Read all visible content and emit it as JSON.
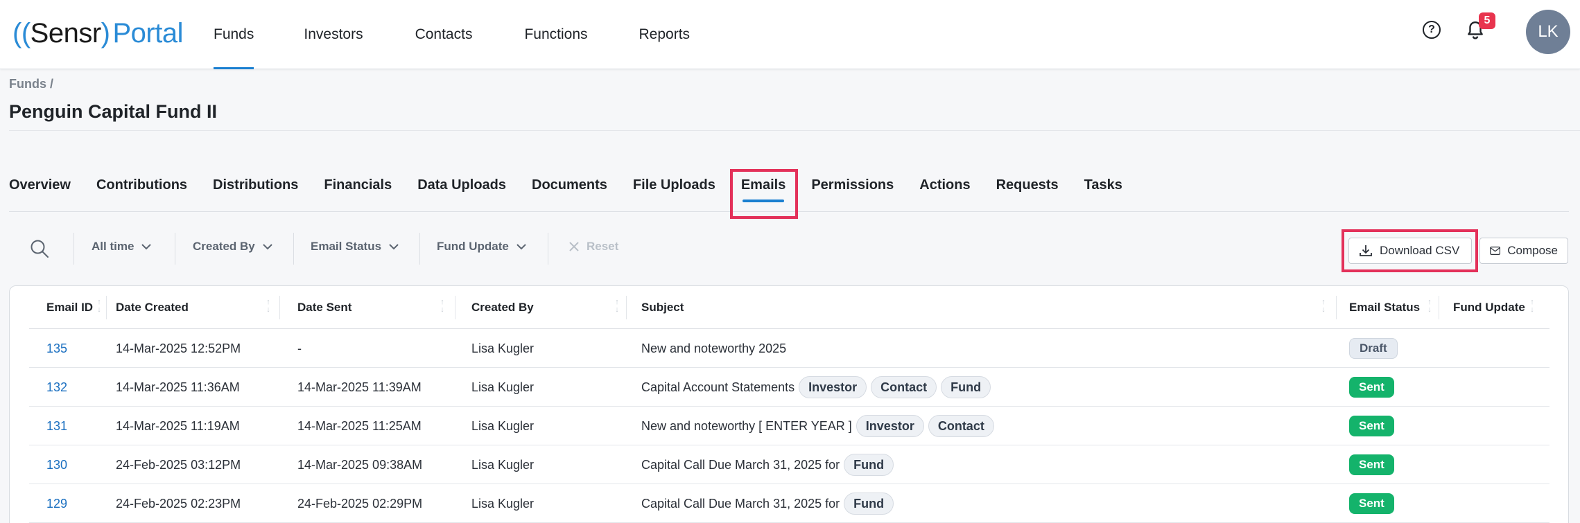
{
  "app": {
    "logo_open": "((",
    "logo_brand": "Sensr",
    "logo_close": ")",
    "logo_product": "Portal",
    "notifications_count": "5",
    "user_initials": "LK"
  },
  "nav": {
    "items": [
      {
        "label": "Funds",
        "active": true
      },
      {
        "label": "Investors",
        "active": false
      },
      {
        "label": "Contacts",
        "active": false
      },
      {
        "label": "Functions",
        "active": false
      },
      {
        "label": "Reports",
        "active": false
      }
    ]
  },
  "header": {
    "breadcrumb": "Funds /",
    "title": "Penguin Capital Fund II"
  },
  "tabs": [
    {
      "label": "Overview"
    },
    {
      "label": "Contributions"
    },
    {
      "label": "Distributions"
    },
    {
      "label": "Financials"
    },
    {
      "label": "Data Uploads"
    },
    {
      "label": "Documents"
    },
    {
      "label": "File Uploads"
    },
    {
      "label": "Emails",
      "active": true
    },
    {
      "label": "Permissions"
    },
    {
      "label": "Actions"
    },
    {
      "label": "Requests"
    },
    {
      "label": "Tasks"
    }
  ],
  "filters": {
    "time": "All time",
    "created_by": "Created By",
    "email_status": "Email Status",
    "fund_update": "Fund Update",
    "reset": "Reset"
  },
  "actions": {
    "download_csv": "Download CSV",
    "compose": "Compose"
  },
  "table": {
    "columns": [
      "Email ID",
      "Date Created",
      "Date Sent",
      "Created By",
      "Subject",
      "Email Status",
      "Fund Update"
    ],
    "rows": [
      {
        "id": "135",
        "created": "14-Mar-2025 12:52PM",
        "sent": "-",
        "by": "Lisa Kugler",
        "subject": "New and noteworthy 2025",
        "tags": [],
        "status": "Draft"
      },
      {
        "id": "132",
        "created": "14-Mar-2025 11:36AM",
        "sent": "14-Mar-2025 11:39AM",
        "by": "Lisa Kugler",
        "subject": "Capital Account Statements",
        "tags": [
          "Investor",
          "Contact",
          "Fund"
        ],
        "status": "Sent"
      },
      {
        "id": "131",
        "created": "14-Mar-2025 11:19AM",
        "sent": "14-Mar-2025 11:25AM",
        "by": "Lisa Kugler",
        "subject": "New and noteworthy [ ENTER YEAR ]",
        "tags": [
          "Investor",
          "Contact"
        ],
        "status": "Sent"
      },
      {
        "id": "130",
        "created": "24-Feb-2025 03:12PM",
        "sent": "14-Mar-2025 09:38AM",
        "by": "Lisa Kugler",
        "subject": "Capital Call Due March 31, 2025 for",
        "tags": [
          "Fund"
        ],
        "status": "Sent"
      },
      {
        "id": "129",
        "created": "24-Feb-2025 02:23PM",
        "sent": "24-Feb-2025 02:29PM",
        "by": "Lisa Kugler",
        "subject": "Capital Call Due March 31, 2025 for",
        "tags": [
          "Fund"
        ],
        "status": "Sent"
      }
    ]
  }
}
